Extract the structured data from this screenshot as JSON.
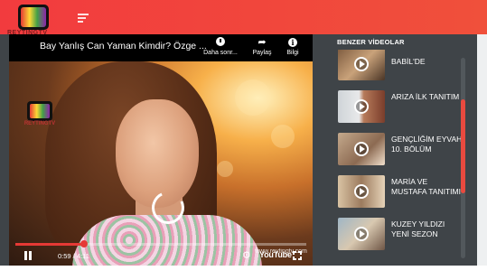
{
  "header": {
    "logo_text": "REYTINGTV",
    "menu_icon": "menu-icon"
  },
  "player": {
    "title": "Bay Yanlış Can Yaman Kimdir? Özge ...",
    "actions": [
      {
        "icon": "clock-icon",
        "label": "Daha sonr..."
      },
      {
        "icon": "share-icon",
        "label": "Paylaş"
      },
      {
        "icon": "info-icon",
        "label": "Bilgi"
      }
    ],
    "watermark_logo_text": "REYTINGTV",
    "watermark_url": "www.reytingtv.com",
    "time": "0:59 / 4:11",
    "progress": 0.235,
    "youtube_label": "YouTube"
  },
  "sidebar": {
    "heading": "BENZER VİDEOLAR",
    "items": [
      {
        "title": "BABİL'DE"
      },
      {
        "title": "ARIZA İLK TANITIM"
      },
      {
        "title": "GENÇLİĞİM EYVAH 10. BÖLÜM"
      },
      {
        "title": "MARİA VE MUSTAFA TANITIMI"
      },
      {
        "title": "KUZEY YILDIZI YENİ SEZON"
      }
    ]
  },
  "colors": {
    "brand_red": "#f23b3e",
    "panel_bg": "#3f4448",
    "progress_red": "#e53935"
  }
}
